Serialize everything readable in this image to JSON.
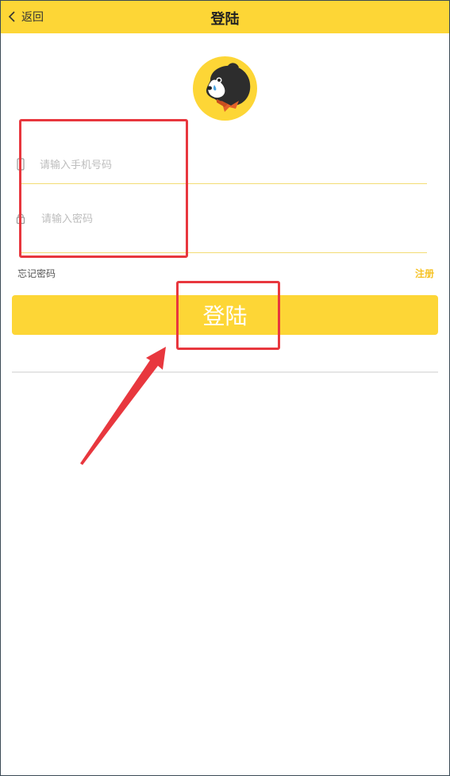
{
  "header": {
    "back_label": "返回",
    "title": "登陆",
    "background": "#fdd636"
  },
  "avatar": {
    "icon": "dog-mascot-avatar"
  },
  "form": {
    "phone_placeholder": "请输入手机号码",
    "phone_value": "",
    "phone_icon": "phone-icon",
    "password_placeholder": "请输入密码",
    "password_value": "",
    "password_icon": "lock-icon"
  },
  "links": {
    "forgot_password": "忘记密码",
    "register": "注册"
  },
  "login_button": {
    "label": "登陆",
    "color": "#fdd636"
  },
  "annotations": {
    "color": "#e8373e"
  }
}
